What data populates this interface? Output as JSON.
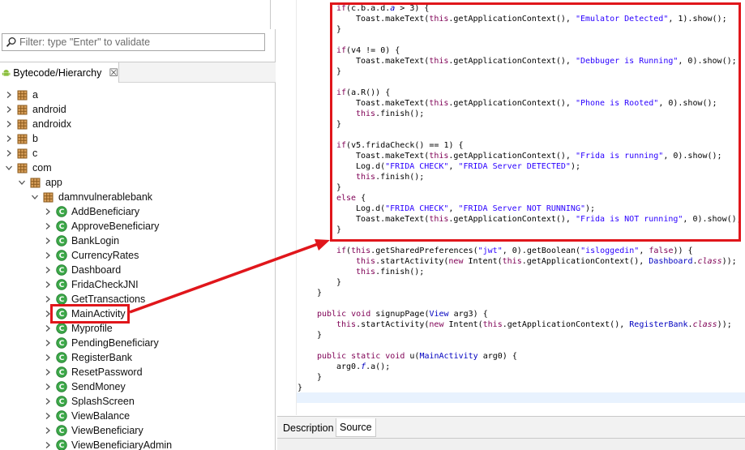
{
  "filter": {
    "placeholder": "Filter: type \"Enter\" to validate"
  },
  "hierarchy_tab": {
    "label": "Bytecode/Hierarchy",
    "close_glyph": "☒"
  },
  "tree": {
    "packages_top": [
      "a",
      "android",
      "androidx",
      "b",
      "c"
    ],
    "com": "com",
    "app": "app",
    "pkg": "damnvulnerablebank",
    "classes": [
      "AddBeneficiary",
      "ApproveBeneficiary",
      "BankLogin",
      "CurrencyRates",
      "Dashboard",
      "FridaCheckJNI",
      "GetTransactions",
      "MainActivity",
      "Myprofile",
      "PendingBeneficiary",
      "RegisterBank",
      "ResetPassword",
      "SendMoney",
      "SplashScreen",
      "ViewBalance",
      "ViewBeneficiary",
      "ViewBeneficiaryAdmin"
    ],
    "selected": "MainActivity"
  },
  "code": {
    "l1": "if(c.b.a.d.a > 3) {",
    "l2": "Toast.makeText(this.getApplicationContext(), \"Emulator Detected\", 1).show();",
    "l3": "}",
    "l4": "if(v4 != 0) {",
    "l5": "Toast.makeText(this.getApplicationContext(), \"Debbuger is Running\", 0).show();",
    "l6": "}",
    "l7": "if(a.R()) {",
    "l8": "Toast.makeText(this.getApplicationContext(), \"Phone is Rooted\", 0).show();",
    "l9": "this.finish();",
    "l10": "}",
    "l11": "if(v5.fridaCheck() == 1) {",
    "l12": "Toast.makeText(this.getApplicationContext(), \"Frida is running\", 0).show();",
    "l13": "Log.d(\"FRIDA CHECK\", \"FRIDA Server DETECTED\");",
    "l14": "this.finish();",
    "l15": "}",
    "l16": "else {",
    "l17": "Log.d(\"FRIDA CHECK\", \"FRIDA Server NOT RUNNING\");",
    "l18": "Toast.makeText(this.getApplicationContext(), \"Frida is NOT running\", 0).show();",
    "l19": "}",
    "l20": "if(this.getSharedPreferences(\"jwt\", 0).getBoolean(\"isloggedin\", false)) {",
    "l21": "this.startActivity(new Intent(this.getApplicationContext(), Dashboard.class));",
    "l22": "this.finish();",
    "l23": "}",
    "l24": "}",
    "l25": "public void signupPage(View arg3) {",
    "l26": "this.startActivity(new Intent(this.getApplicationContext(), RegisterBank.class));",
    "l27": "}",
    "l28": "public static void u(MainActivity arg0) {",
    "l29": "arg0.f.a();",
    "l30": "}",
    "l31": "}"
  },
  "bottom_tabs": {
    "description": "Description",
    "source": "Source"
  },
  "colors": {
    "annotation_red": "#e0161b",
    "keyword": "#7f0055",
    "string": "#2a00ff",
    "class_icon": "#2f9e44",
    "package_icon": "#b5651d"
  }
}
